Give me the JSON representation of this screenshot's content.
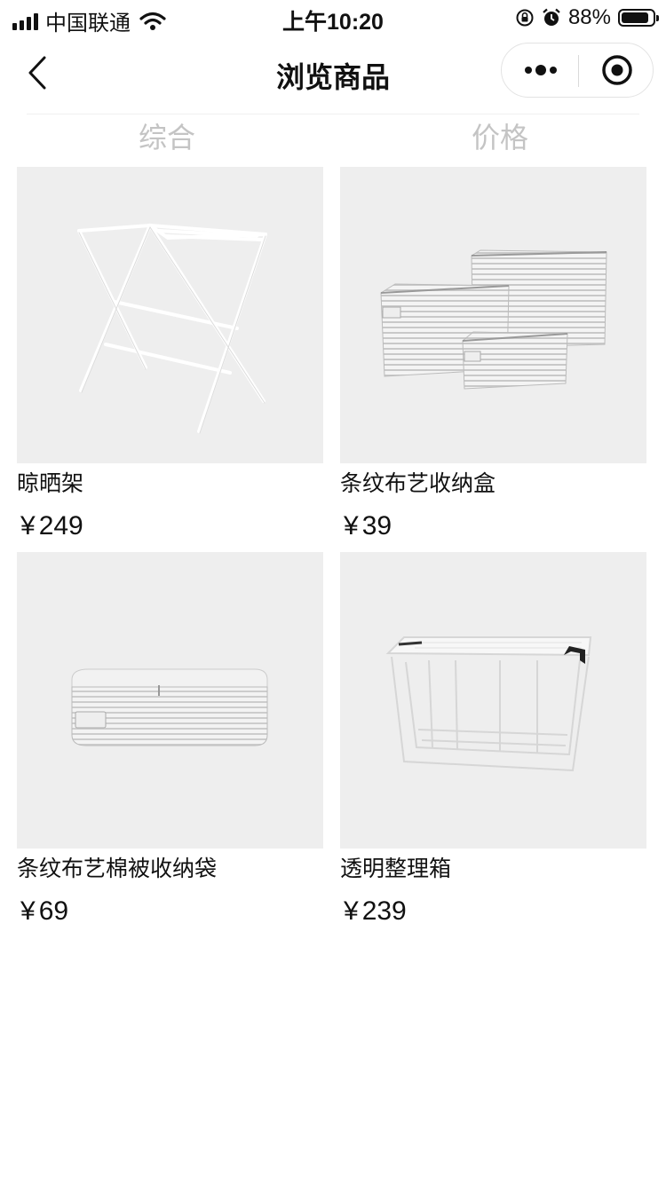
{
  "status_bar": {
    "carrier": "中国联通",
    "time": "上午10:20",
    "battery_percent": "88%",
    "battery_level": 0.88
  },
  "nav": {
    "title": "浏览商品"
  },
  "sort_tabs": [
    {
      "label": "综合"
    },
    {
      "label": "价格"
    }
  ],
  "currency_symbol": "¥",
  "products": [
    {
      "name": "晾晒架",
      "price": "249",
      "image_icon": "drying-rack-image"
    },
    {
      "name": "条纹布艺收纳盒",
      "price": "39",
      "image_icon": "striped-storage-boxes-image"
    },
    {
      "name": "条纹布艺棉被收纳袋",
      "price": "69",
      "image_icon": "quilt-storage-bag-image"
    },
    {
      "name": "透明整理箱",
      "price": "239",
      "image_icon": "transparent-storage-box-image"
    }
  ],
  "colors": {
    "image_bg": "#eeeeee",
    "tab_text": "#c4c4c4",
    "text": "#111111"
  }
}
